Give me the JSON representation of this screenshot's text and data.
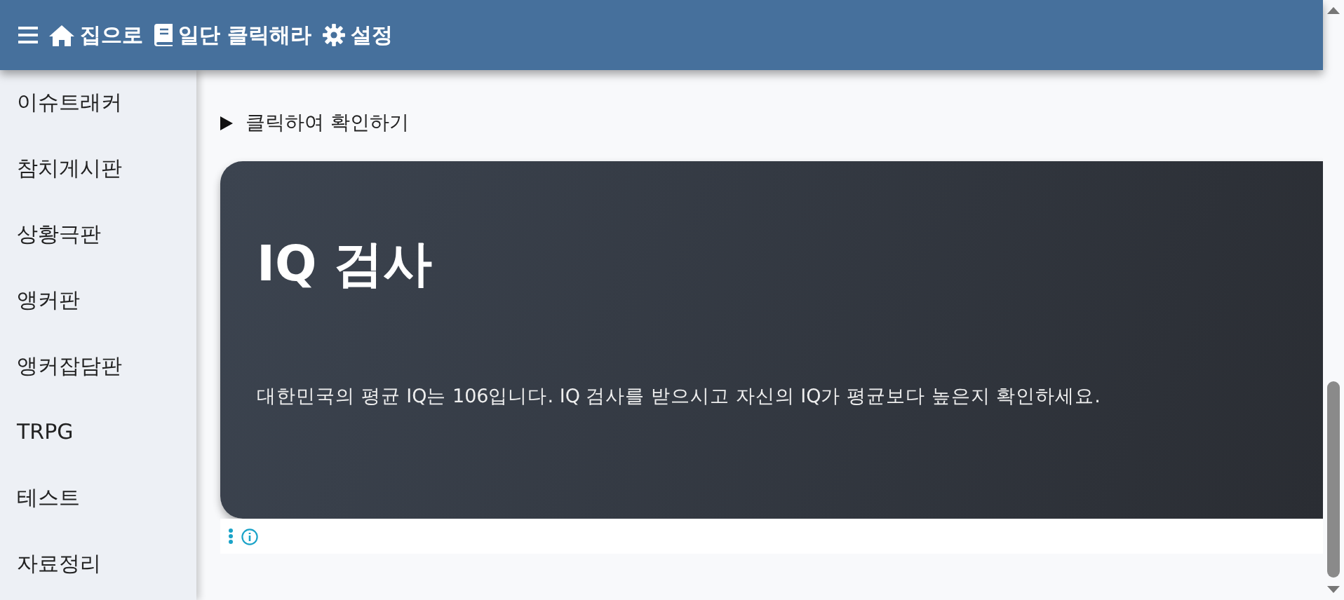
{
  "navbar": {
    "items": [
      {
        "kind": "menu"
      },
      {
        "kind": "home",
        "label": "집으로"
      },
      {
        "kind": "book",
        "label": "일단 클릭해라"
      },
      {
        "kind": "gear",
        "label": "설정"
      }
    ]
  },
  "sidebar": {
    "items": [
      {
        "label": "이슈트래커"
      },
      {
        "label": "참치게시판"
      },
      {
        "label": "상황극판"
      },
      {
        "label": "앵커판"
      },
      {
        "label": "앵커잡담판"
      },
      {
        "label": "TRPG"
      },
      {
        "label": "테스트"
      },
      {
        "label": "자료정리"
      }
    ]
  },
  "details": {
    "summary": "클릭하여 확인하기",
    "expanded": false
  },
  "hero": {
    "title": "IQ 검사",
    "text": "대한민국의 평균 IQ는 106입니다. IQ 검사를 받으시고 자신의 IQ가 평균보다 높은지 확인하세요."
  }
}
